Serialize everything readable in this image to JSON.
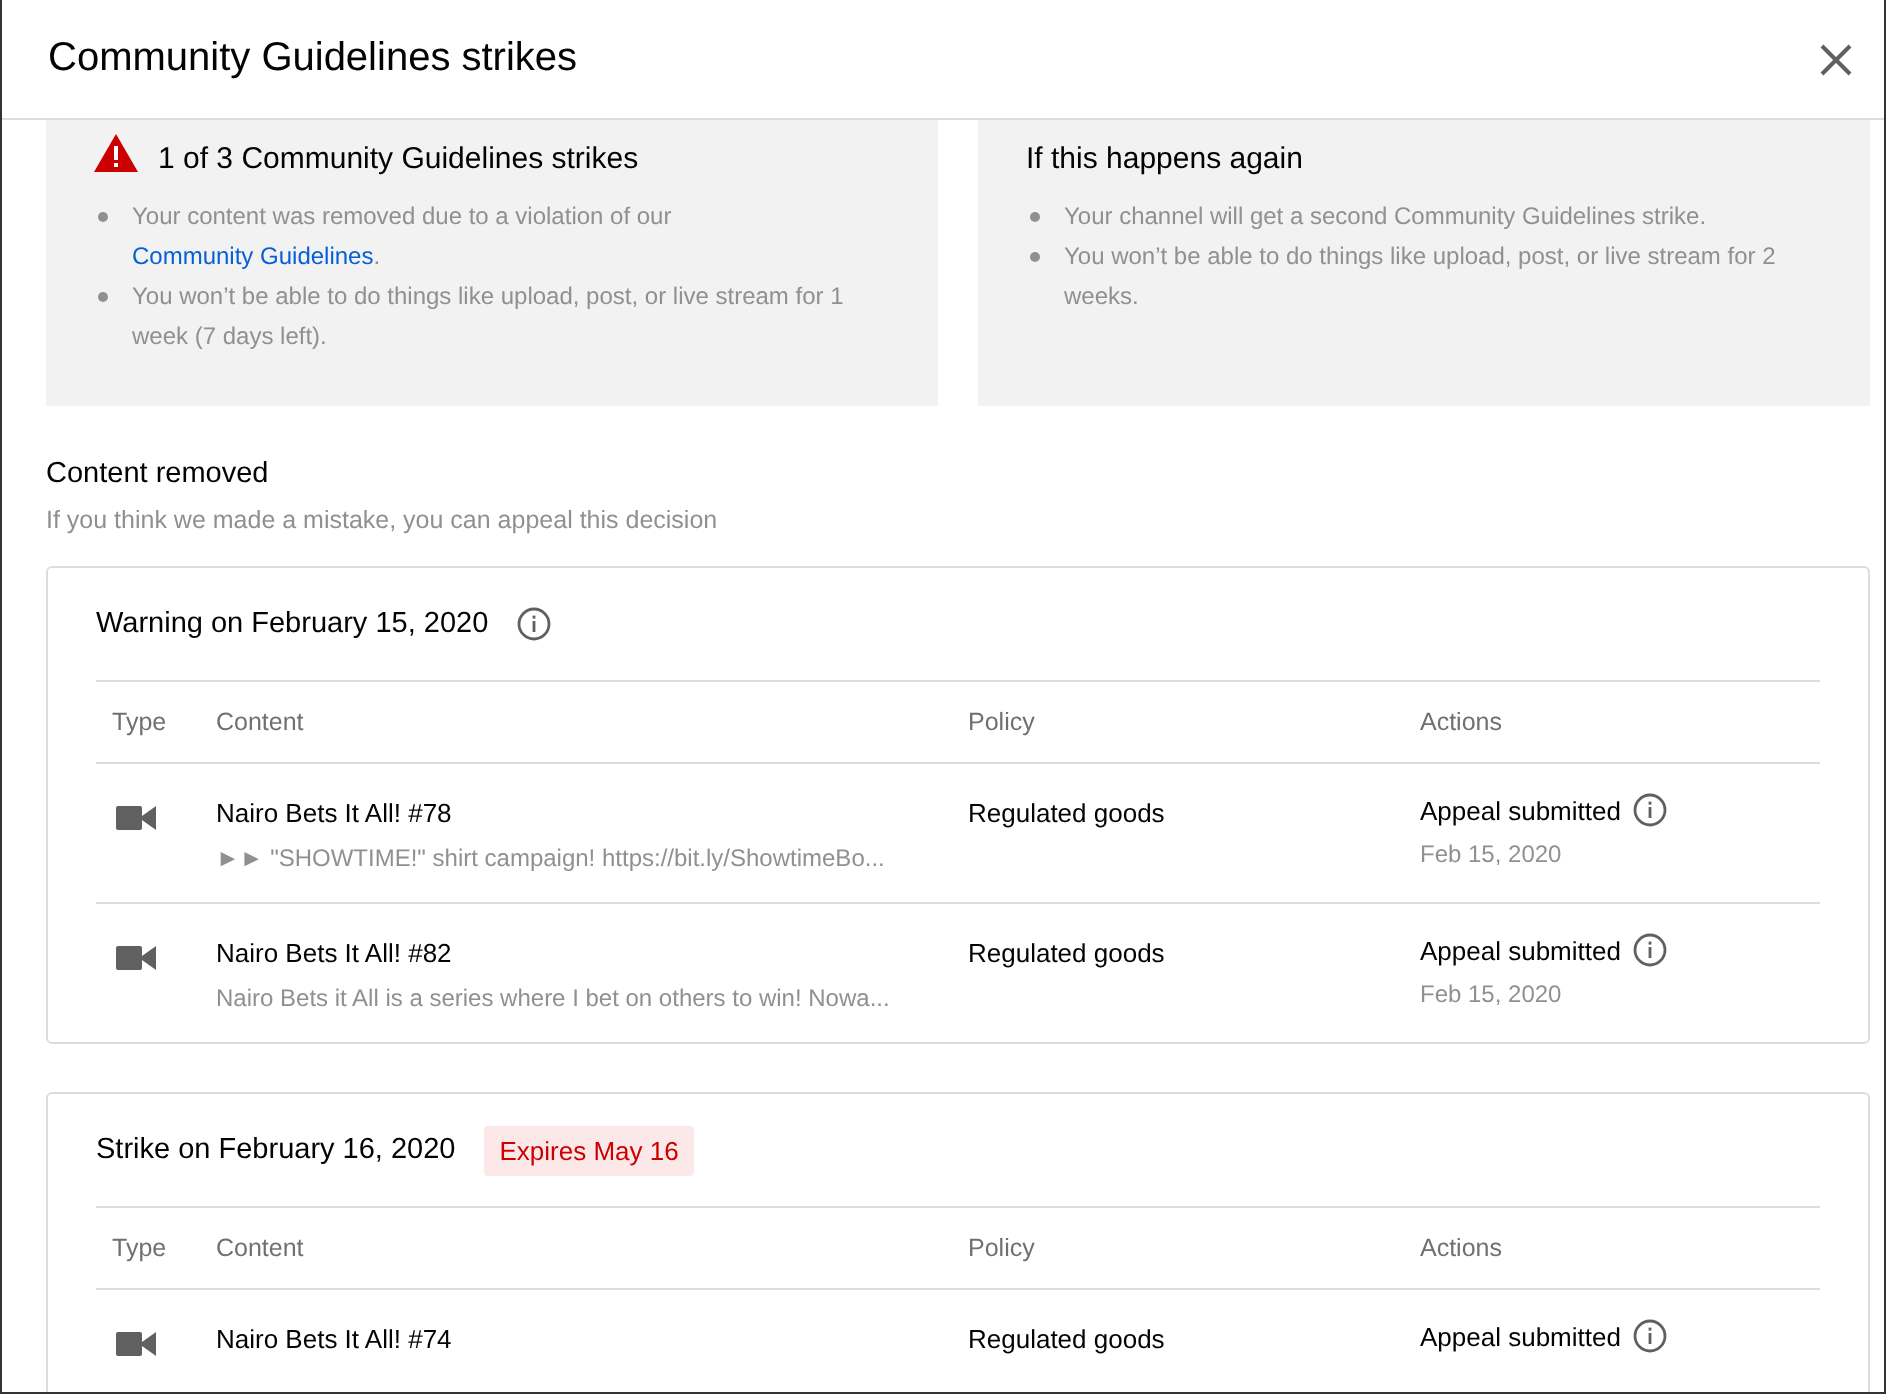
{
  "dialog": {
    "title": "Community Guidelines strikes"
  },
  "summary": [
    {
      "kind": "current",
      "heading": "1 of 3 Community Guidelines strikes",
      "bullets": [
        {
          "text": "Your content was removed due to a violation of our",
          "link": "Community Guidelines",
          "suffix": "."
        },
        {
          "text": "You won’t be able to do things like upload, post, or live stream for 1 week (7 days left)."
        }
      ]
    },
    {
      "kind": "next",
      "heading": "If this happens again",
      "bullets": [
        {
          "text": "Your channel will get a second Community Guidelines strike."
        },
        {
          "text": "You won’t be able to do things like upload, post, or live stream for 2 weeks."
        }
      ]
    }
  ],
  "section": {
    "title": "Content removed",
    "subtitle": "If you think we made a mistake, you can appeal this decision"
  },
  "cards": [
    {
      "kind": "warning",
      "title": "Warning on February 15, 2020",
      "columns": [
        "Type",
        "Content",
        "Policy",
        "Actions"
      ],
      "rows": [
        {
          "title": "Nairo Bets It All! #78",
          "description": "►► \"SHOWTIME!\" shirt campaign! https://bit.ly/ShowtimeBo...",
          "policy": "Regulated goods",
          "action": "Appeal submitted",
          "date": "Feb 15, 2020"
        },
        {
          "title": "Nairo Bets It All! #82",
          "description": "Nairo Bets it All is a series where I bet on others to win! Nowa...",
          "policy": "Regulated goods",
          "action": "Appeal submitted",
          "date": "Feb 15, 2020"
        }
      ]
    },
    {
      "kind": "strike",
      "title": "Strike on February 16, 2020",
      "badge": "Expires May 16",
      "columns": [
        "Type",
        "Content",
        "Policy",
        "Actions"
      ],
      "rows": [
        {
          "title": "Nairo Bets It All! #74",
          "policy": "Regulated goods",
          "action": "Appeal submitted"
        }
      ]
    }
  ]
}
